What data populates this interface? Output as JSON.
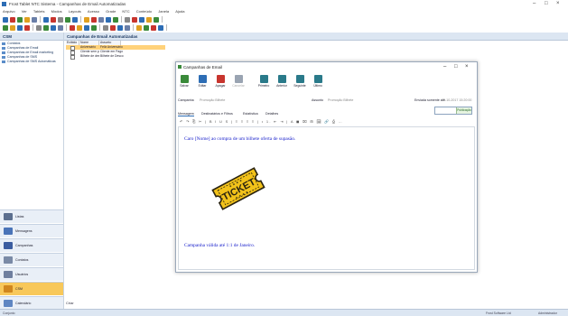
{
  "app": {
    "title": "Frost Tablet NTC Sistema - Campanhas de Email Automatizadas",
    "controls": [
      "–",
      "□",
      "×"
    ]
  },
  "menu": [
    "Arquivo",
    "Ver",
    "Tablets",
    "Modos",
    "Layouts",
    "Acesso",
    "Grade",
    "NTC",
    "Conteúdo",
    "Janela",
    "Ajuda"
  ],
  "left_pane": {
    "header": "CSM",
    "tree": [
      "Contatos",
      "Campanhas de Email",
      "Campanhas de Email marketing",
      "Campanhas de SMS",
      "Campanhas de SMS Automáticas"
    ],
    "nav": [
      {
        "label": "Listas",
        "color": "#5c6f8f"
      },
      {
        "label": "Mensagens",
        "color": "#4a74b8"
      },
      {
        "label": "Campanhas",
        "color": "#3b5da0"
      },
      {
        "label": "Contatos",
        "color": "#7a8aa6"
      },
      {
        "label": "Usuários",
        "color": "#6f7f9f"
      },
      {
        "label": "CSM",
        "color": "#d0861e"
      },
      {
        "label": "Calendário",
        "color": "#5f86c2"
      }
    ],
    "selected_nav": "CSM"
  },
  "list": {
    "header": "Campanhas de Email Automatizadas",
    "columns": [
      "Exibido",
      "Nome",
      "Assunto"
    ],
    "rows": [
      {
        "name": "Aniversário",
        "subject": "Feliz Aniversário"
      },
      {
        "name": "Cliente sem pago",
        "subject": "Cliente em Pago"
      },
      {
        "name": "Bilhete de desco",
        "subject": "Bilhete de Desco"
      }
    ]
  },
  "dialog": {
    "title": "Campanhas de Email",
    "controls": [
      "–",
      "□",
      "×"
    ],
    "ribbon": [
      "Salvar",
      "Editar",
      "Apagar",
      "Cancelar",
      "Primeiro",
      "Anterior",
      "Seguinte",
      "Último"
    ],
    "fields": {
      "campaign_label": "Campanha",
      "campaign_value": "Promoção Bilhete",
      "subject_label": "Assunto",
      "subject_value": "Promoção Bilhete",
      "sent_label": "Enviada somente até",
      "sent_value": "15-10-2017 15:20:00"
    },
    "publish_label": "Publicação",
    "tabs": [
      "Mensagem",
      "Destinatários e Filtros",
      "Estatística",
      "Detalhes"
    ],
    "editor_toolbar": "↶ ↷ ⎘ ✂ | B I U S | ≡ ≡ ≡ ≡ | • 1. ⇤ ⇥ | A ◼ ⌧ ⊞ 🖼 🔗 ⎙ …",
    "body_greeting": "Caro [Nome] ao compra de um bilhete oferta de supasão.",
    "ticket_text": "TICKET",
    "body_validity": "Campanha válida até 1:1 de Janeiro."
  },
  "bottom_nav": "Criar",
  "status": {
    "left": "Conjunto",
    "right_1": "Frost Software Ltd",
    "right_2": "Administrador"
  },
  "colors": {
    "accent": "#2d6db5",
    "selection": "#f8c85a",
    "ticket": "#f2c21a",
    "body_text": "#1b22cc"
  }
}
